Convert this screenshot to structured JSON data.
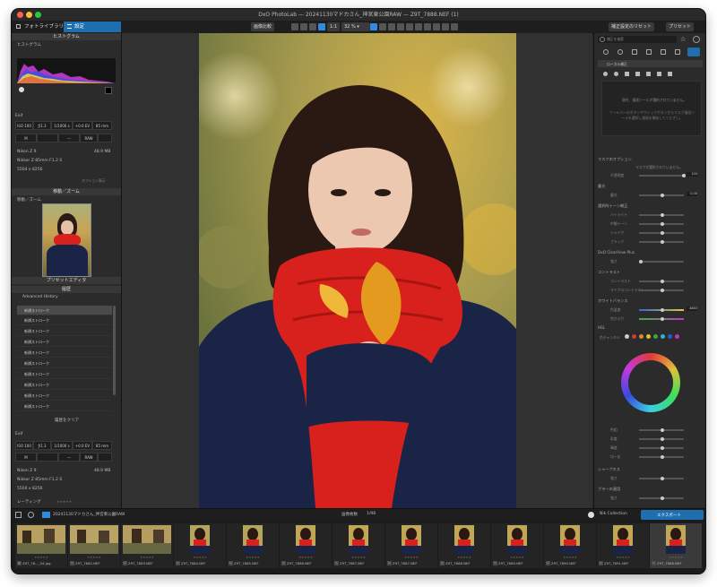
{
  "window": {
    "title": "DxO PhotoLab — 20241130マドカさん_神宮東公園RAW — Z9T_7888.NEF (1)"
  },
  "toolbar": {
    "tab_library": "フォトライブラリ",
    "tab_customize": "設定",
    "compare_label": "画像比較",
    "one_to_one": "1:1",
    "zoom": "32 %",
    "reset_label": "補正設定のリセット",
    "preset_label": "プリセット"
  },
  "left": {
    "histogram_title": "ヒストグラム",
    "hist_sub": "ヒストグラム",
    "hist_channels": [
      "RGB",
      "R",
      "G",
      "B",
      "L"
    ],
    "exif_title": "Exif",
    "exif_row1": [
      "ISO 100",
      "ƒ/1.3",
      "1/1000 s",
      "+0.0 EV",
      "85 mm"
    ],
    "exif_row2": [
      "M",
      "",
      "---",
      "RAW",
      ""
    ],
    "camera": "Nikon Z 9",
    "filesize": "48.9 MB",
    "lens": "Nikkor Z 85mm F1.2 S",
    "dimensions": "5504 x 8256",
    "exif_note": "オプション表示",
    "move_zoom_title": "移動／ズーム",
    "move_zoom_sub": "移動／ズーム",
    "preset_editor_title": "プリセットエディタ",
    "history_title": "履歴",
    "advanced_history": "Advanced History",
    "history_items": [
      "新規ストローク",
      "新規ストローク",
      "新規ストローク",
      "新規ストローク",
      "新規ストローク",
      "新規ストローク",
      "新規ストローク",
      "新規ストローク",
      "新規ストローク",
      "新規ストローク"
    ],
    "clear_history": "履歴をクリア",
    "exif2_title": "Exif",
    "exif2_row1": [
      "ISO 100",
      "ƒ/1.3",
      "1/1000 s",
      "+0.0 EV",
      "85 mm"
    ],
    "exif2_row2": [
      "M",
      "",
      "---",
      "RAW",
      ""
    ],
    "camera2": "Nikon Z 9",
    "filesize2": "48.9 MB",
    "lens2": "Nikkor Z 85mm F1.2 S",
    "dimensions2": "5504 x 8256",
    "rating_label": "レーティング",
    "shot_label": "撮影日",
    "shot_date": "2024/11/30 14:05:59"
  },
  "right": {
    "search_placeholder": "補正を検索",
    "local_adjust": "ローカル補正",
    "empty_msg": "現在、描画ツールが選択されていません。",
    "empty_msg2": "ツールバーのボタンやクイックボタンからマスク描画ツールを選択し描画を開始してください。",
    "mask_options": "マスクのオプション",
    "mask_none": "マスクが選択されていません。",
    "opacity": "不透明度",
    "opacity_val": "100",
    "exposure": "露光",
    "exposure_sub": "露光",
    "exposure_val": "0.00",
    "tone": "選択的トーン補正",
    "tone_items": [
      "ハイライト",
      "中間トーン",
      "シャドウ",
      "ブラック"
    ],
    "clearview": "DxO ClearView Plus",
    "clearview_sub": "強さ",
    "contrast": "コントラスト",
    "contrast_items": [
      "コントラスト",
      "マイクロコントラスト"
    ],
    "wb": "ホワイトバランス",
    "wb_items": [
      "色温度",
      "色かぶり"
    ],
    "wb_val": "4883",
    "hsl": "HSL",
    "hsl_channel": "色チャンネル",
    "hsl_items": [
      "色相",
      "彩度",
      "輝度",
      "均一化"
    ],
    "sharpness": "シャープネス",
    "sharpness_sub": "強さ",
    "blur": "ブラーの適用",
    "blur_sub": "強さ"
  },
  "filmbar": {
    "folder": "20241130マドカさん_神宮東公園RAW",
    "count_label": "画像枚数",
    "count": "1/98",
    "nik_label": "Nik Collection",
    "export_label": "エクスポート"
  },
  "thumbnails": [
    {
      "name": "Z9T_78..._04.jpg",
      "badge": "jp"
    },
    {
      "name": "Z9T_7882.NEF",
      "badge": "n"
    },
    {
      "name": "Z9T_7883.NEF",
      "badge": "n"
    },
    {
      "name": "Z9T_7884.NEF",
      "badge": "n"
    },
    {
      "name": "Z9T_7885.NEF",
      "badge": "n"
    },
    {
      "name": "Z9T_7886.NEF",
      "badge": "n"
    },
    {
      "name": "Z9T_7887.NEF",
      "badge": "n"
    },
    {
      "name": "Z9T_7887.NEF",
      "badge": "n"
    },
    {
      "name": "Z9T_7888.NEF",
      "badge": "n"
    },
    {
      "name": "Z9T_7889.NEF",
      "badge": "n"
    },
    {
      "name": "Z9T_7890.NEF",
      "badge": "n"
    },
    {
      "name": "Z9T_7891.NEF",
      "badge": "n"
    },
    {
      "name": "Z9T_7888.NEF",
      "badge": "n"
    }
  ],
  "colors": {
    "accent": "#1f6fb0",
    "panel": "#2b2b2b",
    "scarf": "#d8211c",
    "sweater": "#1a2447"
  }
}
